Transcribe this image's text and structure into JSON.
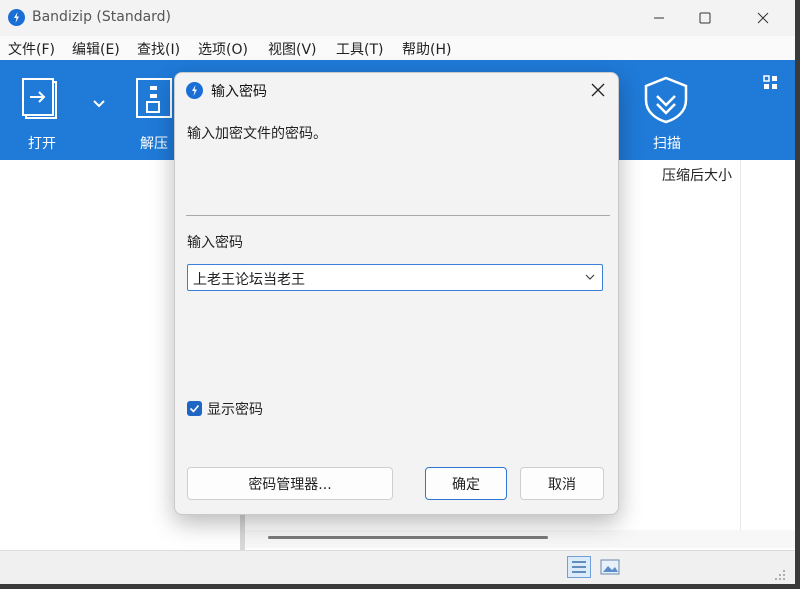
{
  "window": {
    "title": "Bandizip (Standard)",
    "controls": {
      "minimize_icon": "minimize-icon",
      "maximize_icon": "maximize-icon",
      "close_icon": "close-icon"
    }
  },
  "menu": [
    "文件(F)",
    "编辑(E)",
    "查找(I)",
    "选项(O)",
    "视图(V)",
    "工具(T)",
    "帮助(H)"
  ],
  "toolbar": {
    "open_label": "打开",
    "extract_label": "解压",
    "scan_label": "扫描"
  },
  "file_list": {
    "column_compressed_size": "压缩后大小"
  },
  "dialog": {
    "title": "输入密码",
    "message": "输入加密文件的密码。",
    "password_label": "输入密码",
    "password_value": "上老王论坛当老王",
    "show_password_label": "显示密码",
    "show_password_checked": true,
    "password_manager_button": "密码管理器...",
    "ok_button": "确定",
    "cancel_button": "取消"
  },
  "colors": {
    "accent": "#1f7ad8",
    "checkbox": "#1f66c4"
  }
}
